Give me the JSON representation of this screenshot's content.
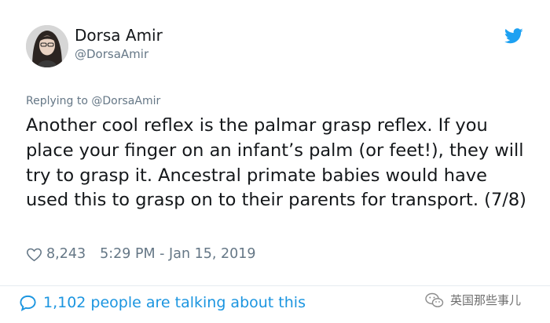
{
  "author": {
    "display_name": "Dorsa Amir",
    "handle": "@DorsaAmir",
    "avatar": "avatar-photo"
  },
  "reply_context": {
    "prefix": "Replying to ",
    "mention": "@DorsaAmir"
  },
  "tweet": {
    "text": "Another cool reflex is the palmar grasp reflex. If you place your finger on an infant’s palm (or feet!), they will try to grasp it. Ancestral primate babies would have used this to grasp on to their parents for transport. (7/8)"
  },
  "meta": {
    "likes": "8,243",
    "timestamp": "5:29 PM - Jan 15, 2019",
    "like_icon": "heart-icon"
  },
  "footer": {
    "talking_text": "1,102 people are talking about this",
    "talking_icon": "speech-bubble-icon"
  },
  "watermark": {
    "text": "英国那些事儿",
    "icon": "wechat-icon"
  },
  "colors": {
    "link_blue": "#1b95e0",
    "twitter_blue": "#1da1f2",
    "secondary_gray": "#657786",
    "text": "#14171a",
    "divider": "#e6ecf0"
  }
}
